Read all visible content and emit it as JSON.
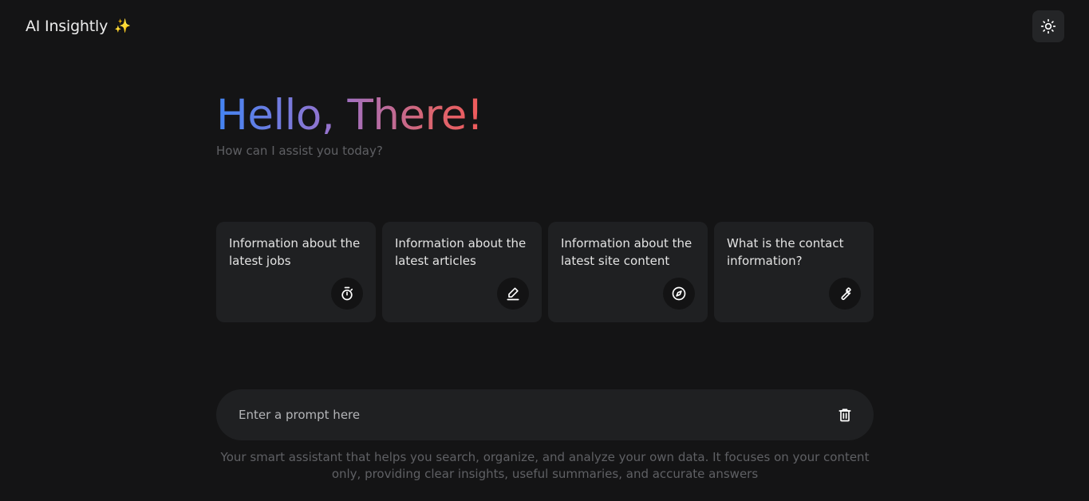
{
  "header": {
    "app_title": "AI Insightly",
    "sparkle_icon": "sparkle-icon",
    "theme_toggle_icon": "sun-icon"
  },
  "hero": {
    "greeting": "Hello, There!",
    "subtitle": "How can I assist you today?",
    "gradient_colors": [
      "#4285f4",
      "#9b72cb",
      "#d96570",
      "#f25a5a"
    ]
  },
  "suggestions": [
    {
      "text": "Information about the latest jobs",
      "icon": "timer-icon"
    },
    {
      "text": "Information about the latest articles",
      "icon": "pencil-icon"
    },
    {
      "text": "Information about the latest site content",
      "icon": "compass-icon"
    },
    {
      "text": "What is the contact information?",
      "icon": "wrench-icon"
    }
  ],
  "prompt": {
    "placeholder": "Enter a prompt here",
    "value": "",
    "clear_icon": "trash-icon"
  },
  "footer": {
    "disclaimer": "Your smart assistant that helps you search, organize, and analyze your own data. It focuses on your content only, providing clear insights, useful summaries, and accurate answers"
  },
  "colors": {
    "background": "#141415",
    "card": "#1f2022",
    "muted_text": "#5f6064"
  }
}
